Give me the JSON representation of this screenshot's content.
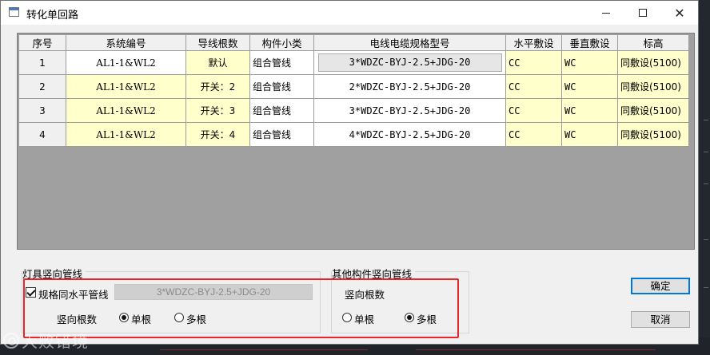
{
  "window": {
    "title": "转化单回路",
    "controls": {
      "minimize": "—",
      "maximize": "□",
      "close": "✕"
    }
  },
  "grid": {
    "columns": [
      "序号",
      "系统编号",
      "导线根数",
      "构件小类",
      "电线电缆规格型号",
      "水平敷设",
      "垂直敷设",
      "标高"
    ],
    "rows": [
      {
        "index": "1",
        "code": "AL1-1&WL2",
        "count": "默认",
        "category": "组合管线",
        "spec": "3*WDZC-BYJ-2.5+JDG-20",
        "horizontal": "CC",
        "vertical": "WC",
        "elevation": "同敷设(5100)"
      },
      {
        "index": "2",
        "code": "AL1-1&WL2",
        "count": "开关：2",
        "category": "组合管线",
        "spec": "2*WDZC-BYJ-2.5+JDG-20",
        "horizontal": "CC",
        "vertical": "WC",
        "elevation": "同敷设(5100)"
      },
      {
        "index": "3",
        "code": "AL1-1&WL2",
        "count": "开关：3",
        "category": "组合管线",
        "spec": "3*WDZC-BYJ-2.5+JDG-20",
        "horizontal": "CC",
        "vertical": "WC",
        "elevation": "同敷设(5100)"
      },
      {
        "index": "4",
        "code": "AL1-1&WL2",
        "count": "开关：4",
        "category": "组合管线",
        "spec": "4*WDZC-BYJ-2.5+JDG-20",
        "horizontal": "CC",
        "vertical": "WC",
        "elevation": "同敷设(5100)"
      }
    ]
  },
  "lamp_group": {
    "title": "灯具竖向管线",
    "same_spec_label": "规格同水平管线",
    "same_spec_checked": true,
    "spec_value": "3*WDZC-BYJ-2.5+JDG-20",
    "vertical_count_label": "竖向根数",
    "single_label": "单根",
    "multi_label": "多根",
    "selected": "单根"
  },
  "other_group": {
    "title": "其他构件竖向管线",
    "vertical_count_label": "竖向根数",
    "single_label": "单根",
    "multi_label": "多根",
    "selected": "多根"
  },
  "buttons": {
    "ok": "确定",
    "cancel": "取消"
  },
  "watermark": "大败错境",
  "colors": {
    "highlight": "#e8262a",
    "yellow_cell": "#ffffcc",
    "grid_bg": "#a0a0a0"
  }
}
